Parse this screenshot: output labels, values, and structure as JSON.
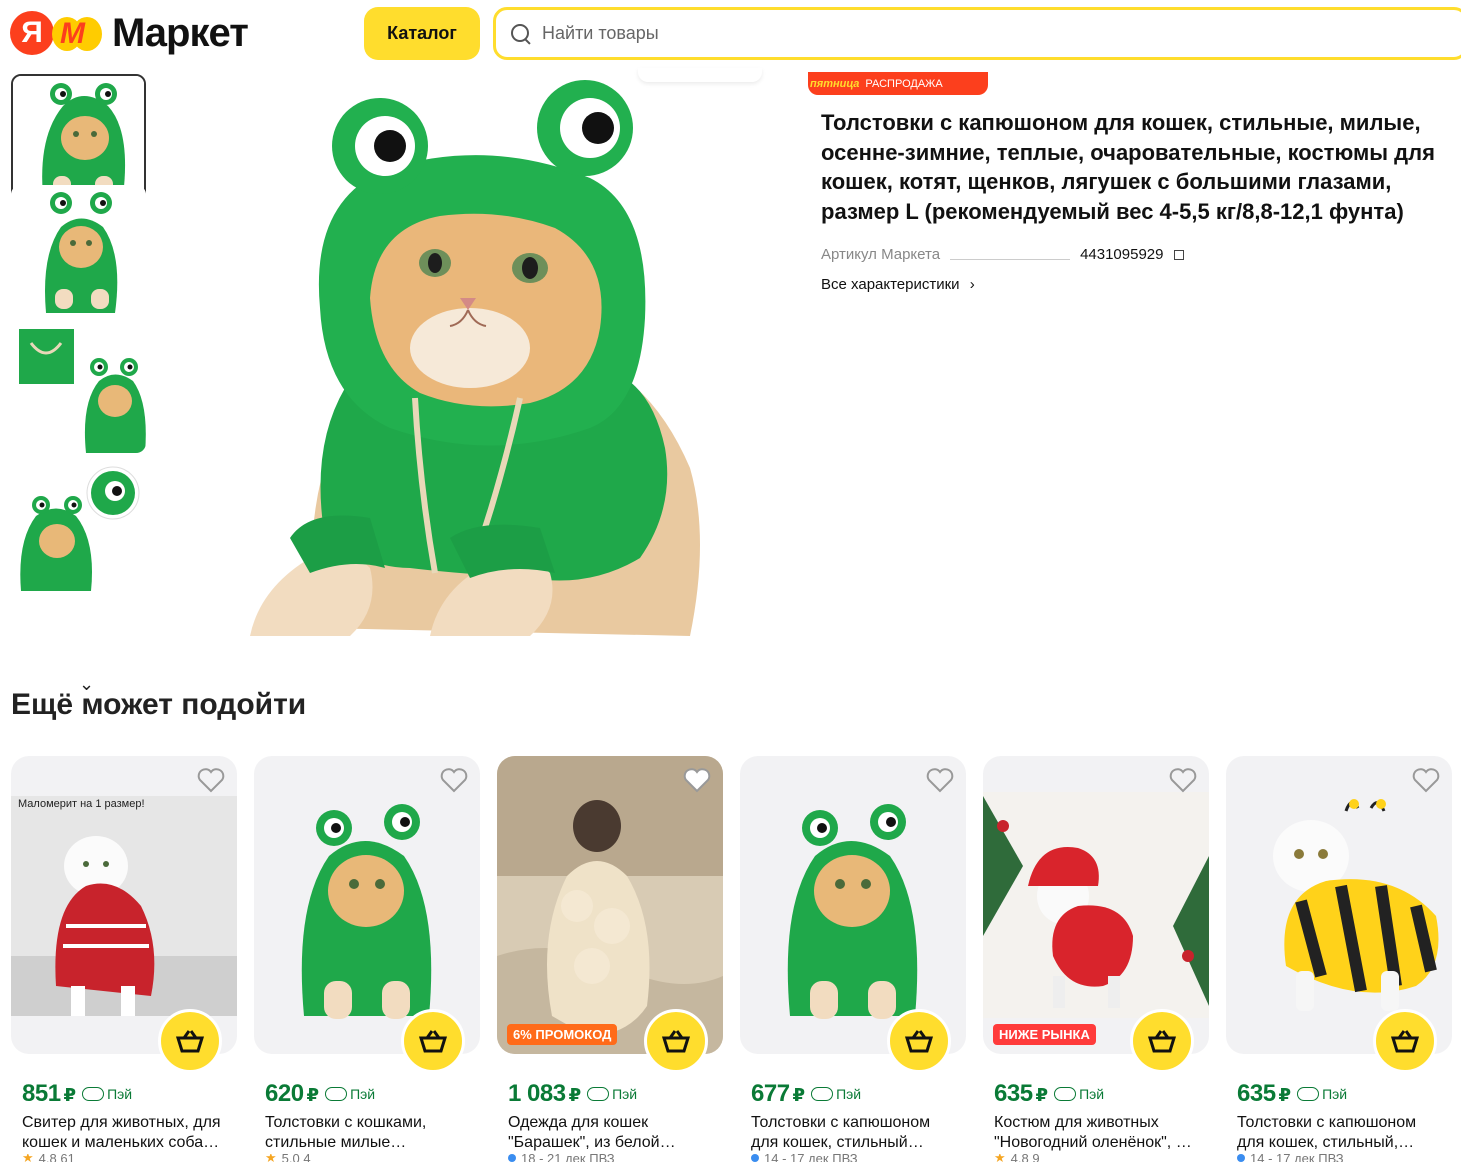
{
  "header": {
    "logo_ya": "Я",
    "logo_text": "Маркет",
    "catalog_label": "Каталог",
    "search_placeholder": "Найти товары"
  },
  "product": {
    "sale_badge_brand": "пятница",
    "sale_badge_label": "РАСПРОДАЖА",
    "title": "Толстовки с капюшоном для кошек, стильные, милые, осенне-зимние, теплые, очаровательные, костюмы для кошек, котят, щенков, лягушек с большими глазами, размер L (рекомендуемый вес 4-5,5 кг/8,8-12,1 фунта)",
    "sku_label": "Артикул Маркета",
    "sku_value": "4431095929",
    "characteristics_link": "Все характеристики",
    "characteristics_chevron": "›"
  },
  "gallery": {
    "down_arrow": "⌄"
  },
  "recommendations": {
    "title": "Ещё может подойти",
    "pay_label": "Пэй",
    "currency": "₽",
    "cards": [
      {
        "price": "851",
        "title": "Свитер для животных, для кошек и маленьких соба…",
        "image_caption": "Маломерит на 1 размер!",
        "promo": "",
        "rating": "4,8",
        "extra": "61"
      },
      {
        "price": "620",
        "title": "Толстовки с кошками, стильные милые…",
        "promo": "",
        "rating": "5,0",
        "extra": "4"
      },
      {
        "price": "1 083",
        "title": "Одежда для кошек \"Барашек\", из белой…",
        "promo": "6% ПРОМОКОД",
        "delivery": "18 - 21 дек",
        "pickup": "ПВЗ"
      },
      {
        "price": "677",
        "title": "Толстовки с капюшоном для кошек, стильный…",
        "promo": "",
        "delivery": "14 - 17 дек",
        "pickup": "ПВЗ"
      },
      {
        "price": "635",
        "title": "Костюм для животных \"Новогодний оленёнок\", …",
        "promo": "НИЖЕ РЫНКА",
        "rating": "4,8",
        "extra": "9"
      },
      {
        "price": "635",
        "title": "Толстовки с капюшоном для кошек, стильный,…",
        "promo": "",
        "delivery": "14 - 17 дек",
        "pickup": "ПВЗ"
      }
    ]
  },
  "colors": {
    "brand_yellow": "#ffdd2d",
    "brand_red": "#fc3f1d",
    "price_green": "#0a7a36",
    "frog_green": "#1fa84a"
  }
}
